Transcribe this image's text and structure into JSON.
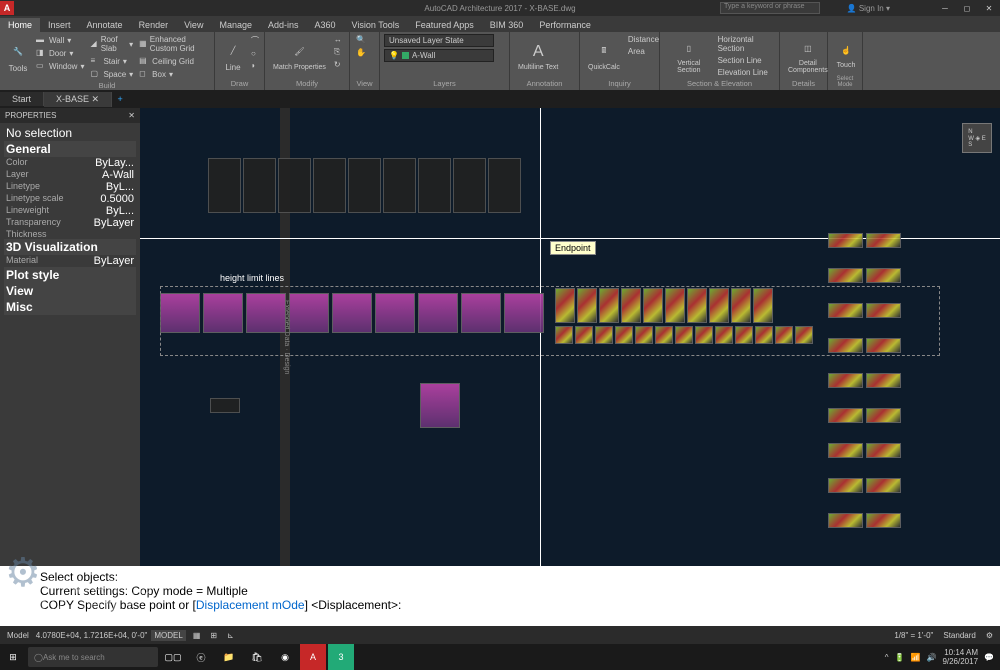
{
  "title": "AutoCAD Architecture 2017 - X-BASE.dwg",
  "app_letter": "A",
  "search_placeholder": "Type a keyword or phrase",
  "signin": "Sign In",
  "ribbon_tabs": [
    "Home",
    "Insert",
    "Annotate",
    "Render",
    "View",
    "Manage",
    "Add-ins",
    "A360",
    "Vision Tools",
    "Featured Apps",
    "BIM 360",
    "Performance"
  ],
  "ribbon": {
    "build": {
      "label": "Build",
      "tools": "Tools",
      "col1": [
        "Wall",
        "Door",
        "Window"
      ],
      "col2": [
        "Roof Slab",
        "Stair",
        "Space"
      ],
      "col3": [
        "Enhanced Custom Grid",
        "Ceiling Grid",
        "Box"
      ]
    },
    "draw": {
      "label": "Draw",
      "line": "Line"
    },
    "modify": {
      "label": "Modify",
      "match": "Match\nProperties"
    },
    "view": {
      "label": "View"
    },
    "layers": {
      "label": "Layers",
      "state": "Unsaved Layer State",
      "current": "A-Wall"
    },
    "annotation": {
      "label": "Annotation",
      "multiline": "Multiline\nText"
    },
    "inquiry": {
      "label": "Inquiry",
      "quickcalc": "QuickCalc",
      "distance": "Distance",
      "area": "Area"
    },
    "section": {
      "label": "Section & Elevation",
      "vertical": "Vertical\nSection",
      "horiz": "Horizontal Section",
      "sline": "Section Line",
      "eline": "Elevation Line"
    },
    "details": {
      "label": "Details",
      "detail": "Detail\nComponents"
    },
    "mode": {
      "label": "Select Mode",
      "touch": "Touch"
    }
  },
  "doc_tabs": [
    "Start",
    "X-BASE"
  ],
  "properties": {
    "title": "PROPERTIES",
    "selection": "No selection",
    "groups": [
      {
        "name": "General",
        "rows": [
          {
            "k": "Color",
            "v": "ByLay..."
          },
          {
            "k": "Layer",
            "v": "A-Wall"
          },
          {
            "k": "Linetype",
            "v": "ByL..."
          },
          {
            "k": "Linetype scale",
            "v": "0.5000"
          },
          {
            "k": "Lineweight",
            "v": "ByL..."
          },
          {
            "k": "Transparency",
            "v": "ByLayer"
          },
          {
            "k": "Thickness",
            "v": ""
          }
        ]
      },
      {
        "name": "3D Visualization",
        "rows": [
          {
            "k": "Material",
            "v": "ByLayer"
          }
        ]
      },
      {
        "name": "Plot style",
        "rows": []
      },
      {
        "name": "View",
        "rows": []
      },
      {
        "name": "Misc",
        "rows": []
      }
    ]
  },
  "canvas": {
    "tooltip": "Endpoint",
    "note": "height limit lines"
  },
  "commandline": {
    "l1": "Select objects:",
    "l2_a": "Current settings:  Copy mode = Multiple",
    "l3_a": "COPY Specify base point or [",
    "l3_opt1": "Displacement",
    "l3_opt2": "mOde",
    "l3_b": "] <Displacement>:"
  },
  "statusbar": {
    "layout": "Model",
    "coords": "4.0780E+04, 1.7216E+04, 0'-0\"",
    "model": "MODEL",
    "scale": "1/8\" = 1'-0\"",
    "style": "Standard"
  },
  "taskbar": {
    "search": "Ask me to search",
    "time": "10:14 AM",
    "date": "9/26/2017"
  },
  "watermark": {
    "l1": "SOFTWARES",
    "l2": "ACADEMY"
  }
}
